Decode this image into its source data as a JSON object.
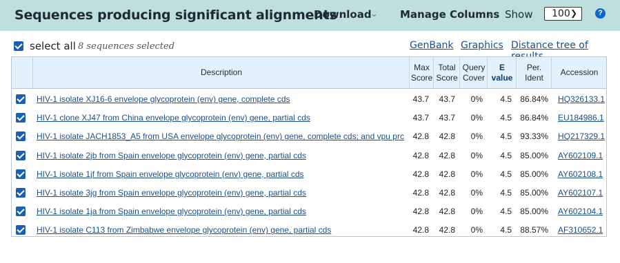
{
  "header": {
    "title": "Sequences producing significant alignments",
    "download_label": "Download",
    "manage_columns_label": "Manage Columns",
    "show_label": "Show",
    "show_value": "100",
    "help_glyph": "?"
  },
  "toolbar": {
    "select_all_label": "select all",
    "selected_count": "8 sequences selected",
    "links": [
      "GenBank",
      "Graphics",
      "Distance tree of results"
    ]
  },
  "table": {
    "columns": {
      "description": "Description",
      "max_score": [
        "Max",
        "Score"
      ],
      "total_score": [
        "Total",
        "Score"
      ],
      "query_cover": [
        "Query",
        "Cover"
      ],
      "e_value": [
        "E",
        "value"
      ],
      "per_ident": [
        "Per.",
        "Ident"
      ],
      "accession": "Accession"
    },
    "rows": [
      {
        "description": "HIV-1 isolate XJ16-6 envelope glycoprotein (env) gene, complete cds",
        "max": "43.7",
        "total": "43.7",
        "cover": "0%",
        "e": "4.5",
        "ident": "86.84%",
        "acc": "HQ326133.1"
      },
      {
        "description": "HIV-1 clone XJ47 from China envelope glycoprotein (env) gene, partial cds",
        "max": "43.7",
        "total": "43.7",
        "cover": "0%",
        "e": "4.5",
        "ident": "86.84%",
        "acc": "EU184986.1"
      },
      {
        "description": "HIV-1 isolate JACH1853_A5 from USA envelope glycoprotein (env) gene, complete cds; and vpu prc",
        "max": "42.8",
        "total": "42.8",
        "cover": "0%",
        "e": "4.5",
        "ident": "93.33%",
        "acc": "HQ217329.1"
      },
      {
        "description": "HIV-1 isolate 2jb from Spain envelope glycoprotein (env) gene, partial cds",
        "max": "42.8",
        "total": "42.8",
        "cover": "0%",
        "e": "4.5",
        "ident": "85.00%",
        "acc": "AY602109.1"
      },
      {
        "description": "HIV-1 isolate 1jf from Spain envelope glycoprotein (env) gene, partial cds",
        "max": "42.8",
        "total": "42.8",
        "cover": "0%",
        "e": "4.5",
        "ident": "85.00%",
        "acc": "AY602108.1"
      },
      {
        "description": "HIV-1 isolate 3jg from Spain envelope glycoprotein (env) gene, partial cds",
        "max": "42.8",
        "total": "42.8",
        "cover": "0%",
        "e": "4.5",
        "ident": "85.00%",
        "acc": "AY602107.1"
      },
      {
        "description": "HIV-1 isolate 1ja from Spain envelope glycoprotein (env) gene, partial cds",
        "max": "42.8",
        "total": "42.8",
        "cover": "0%",
        "e": "4.5",
        "ident": "85.00%",
        "acc": "AY602104.1"
      },
      {
        "description": "HIV-1 isolate C113 from Zimbabwe envelope glycoprotein (env) gene, partial cds",
        "max": "42.8",
        "total": "42.8",
        "cover": "0%",
        "e": "4.5",
        "ident": "88.57%",
        "acc": "AF310652.1"
      }
    ]
  }
}
